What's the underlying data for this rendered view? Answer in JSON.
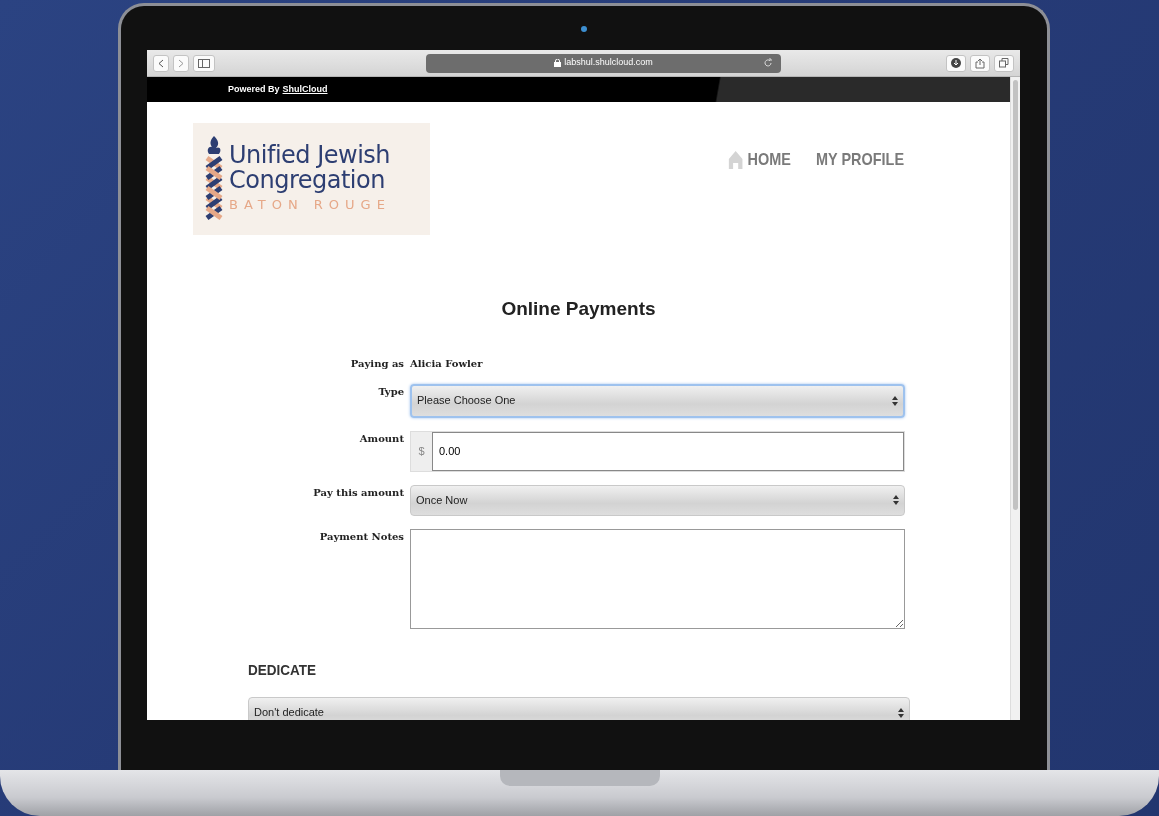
{
  "browser": {
    "url": "labshul.shulcloud.com"
  },
  "top_bar": {
    "prefix": "Powered By",
    "link": "ShulCloud"
  },
  "logo": {
    "line_1": "Unified Jewish",
    "line_2": "Congregation",
    "line_3": "BATON ROUGE"
  },
  "nav": [
    {
      "label": "HOME",
      "kind": "home"
    },
    {
      "label": "MY PROFILE",
      "kind": "plain"
    }
  ],
  "title": "Online Payments",
  "form": {
    "paying_as_label": "Paying as",
    "paying_as_value": "Alicia Fowler",
    "fields": [
      {
        "kind": "select",
        "label": "Type",
        "value": "Please Choose One",
        "focused": true
      },
      {
        "kind": "money",
        "label": "Amount",
        "prefix": "$",
        "value": "0.00"
      },
      {
        "kind": "select",
        "label": "Pay this amount",
        "value": "Once Now",
        "focused": false
      },
      {
        "kind": "textarea",
        "label": "Payment Notes"
      }
    ]
  },
  "dedicate": {
    "heading": "DEDICATE",
    "value": "Don't dedicate"
  }
}
